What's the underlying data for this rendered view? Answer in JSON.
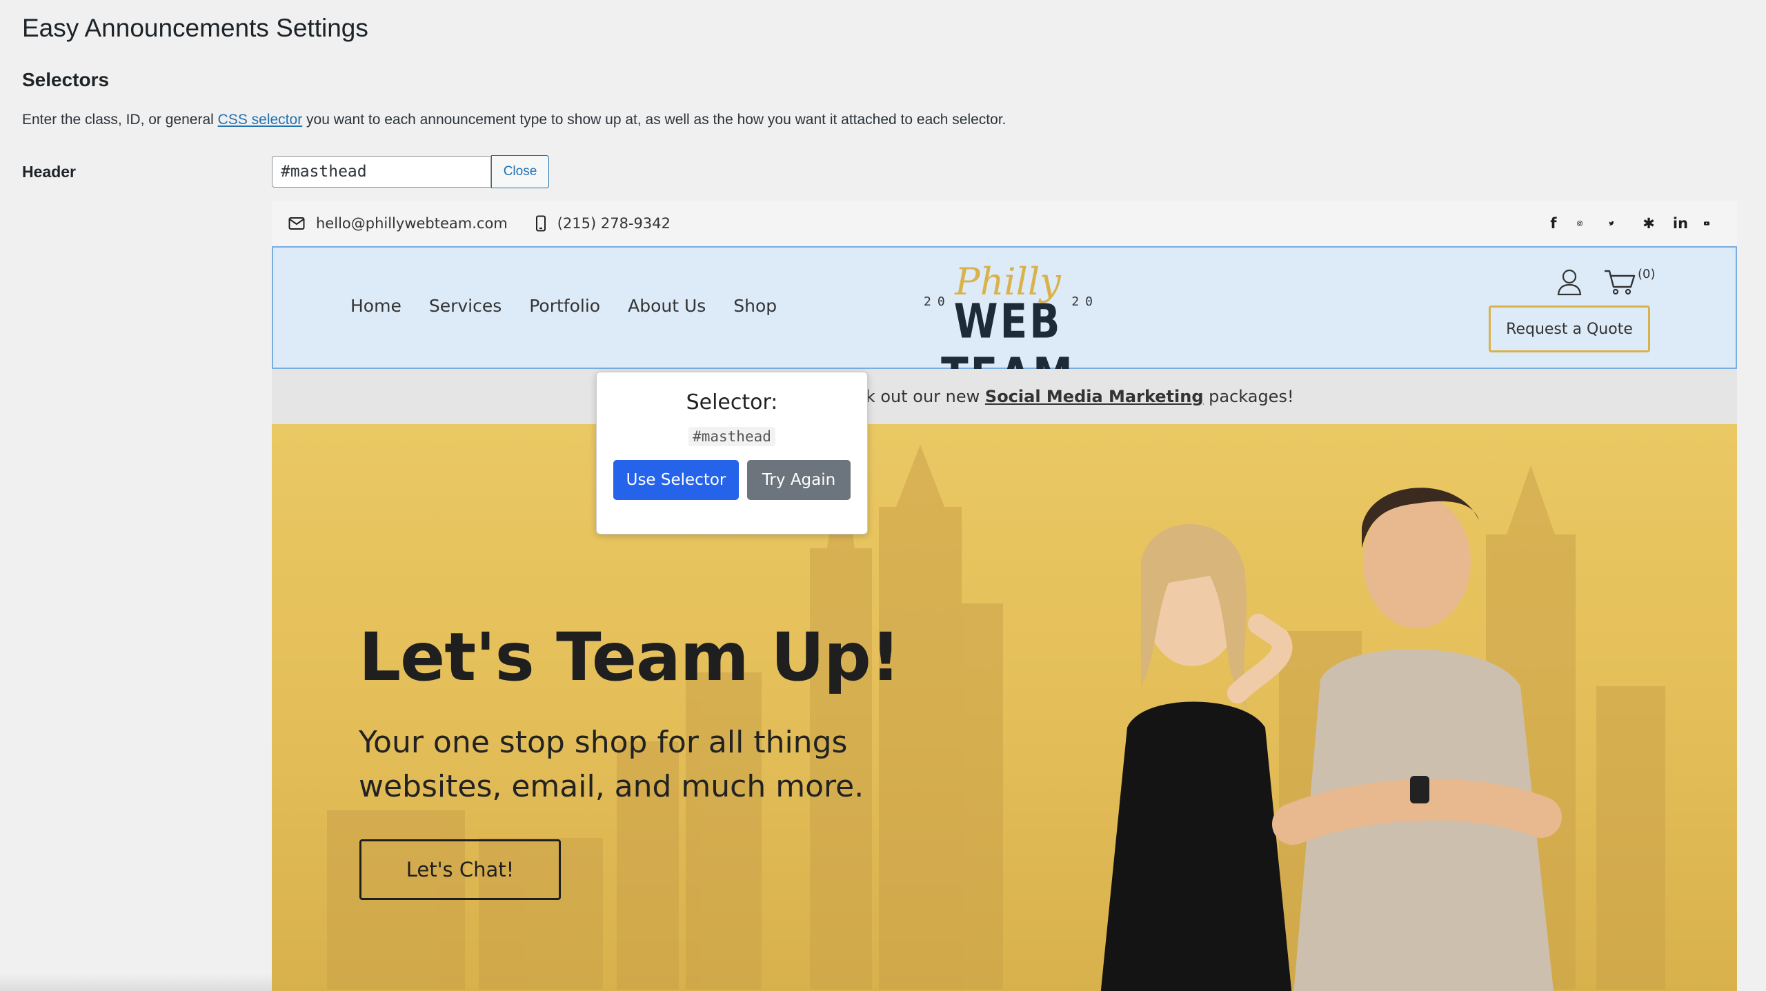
{
  "page": {
    "title": "Easy Announcements Settings",
    "section_title": "Selectors",
    "description_before": "Enter the class, ID, or general ",
    "description_link": "CSS selector",
    "description_after": " you want to each announcement type to show up at, as well as the how you want it attached to each selector.",
    "field_label": "Header",
    "selector_value": "#masthead",
    "close_label": "Close"
  },
  "site": {
    "topbar": {
      "email": "hello@phillywebteam.com",
      "phone": "(215) 278-9342",
      "social_icons": [
        "facebook-icon",
        "instagram-icon",
        "twitter-icon",
        "yelp-icon",
        "linkedin-icon",
        "youtube-icon"
      ]
    },
    "nav": [
      "Home",
      "Services",
      "Portfolio",
      "About Us",
      "Shop"
    ],
    "logo": {
      "script": "Philly",
      "year_left": "20",
      "year_right": "20",
      "main": "WEB TEAM"
    },
    "cart_count": "(0)",
    "quote_label": "Request a Quote",
    "announcement": {
      "before": "Make sure to check out our new ",
      "link": "Social Media Marketing",
      "after": " packages!"
    },
    "hero": {
      "title": "Let's Team Up!",
      "subtitle": "Your one stop shop for all things websites, email, and much more.",
      "cta": "Let's Chat!"
    }
  },
  "popup": {
    "title": "Selector:",
    "code": "#masthead",
    "use_label": "Use Selector",
    "try_label": "Try Again"
  },
  "colors": {
    "highlight_bg": "#ddeaf7",
    "highlight_border": "#7aaee0",
    "accent_gold": "#d9b24a",
    "primary_blue": "#2563eb",
    "secondary_gray": "#6c757d"
  }
}
